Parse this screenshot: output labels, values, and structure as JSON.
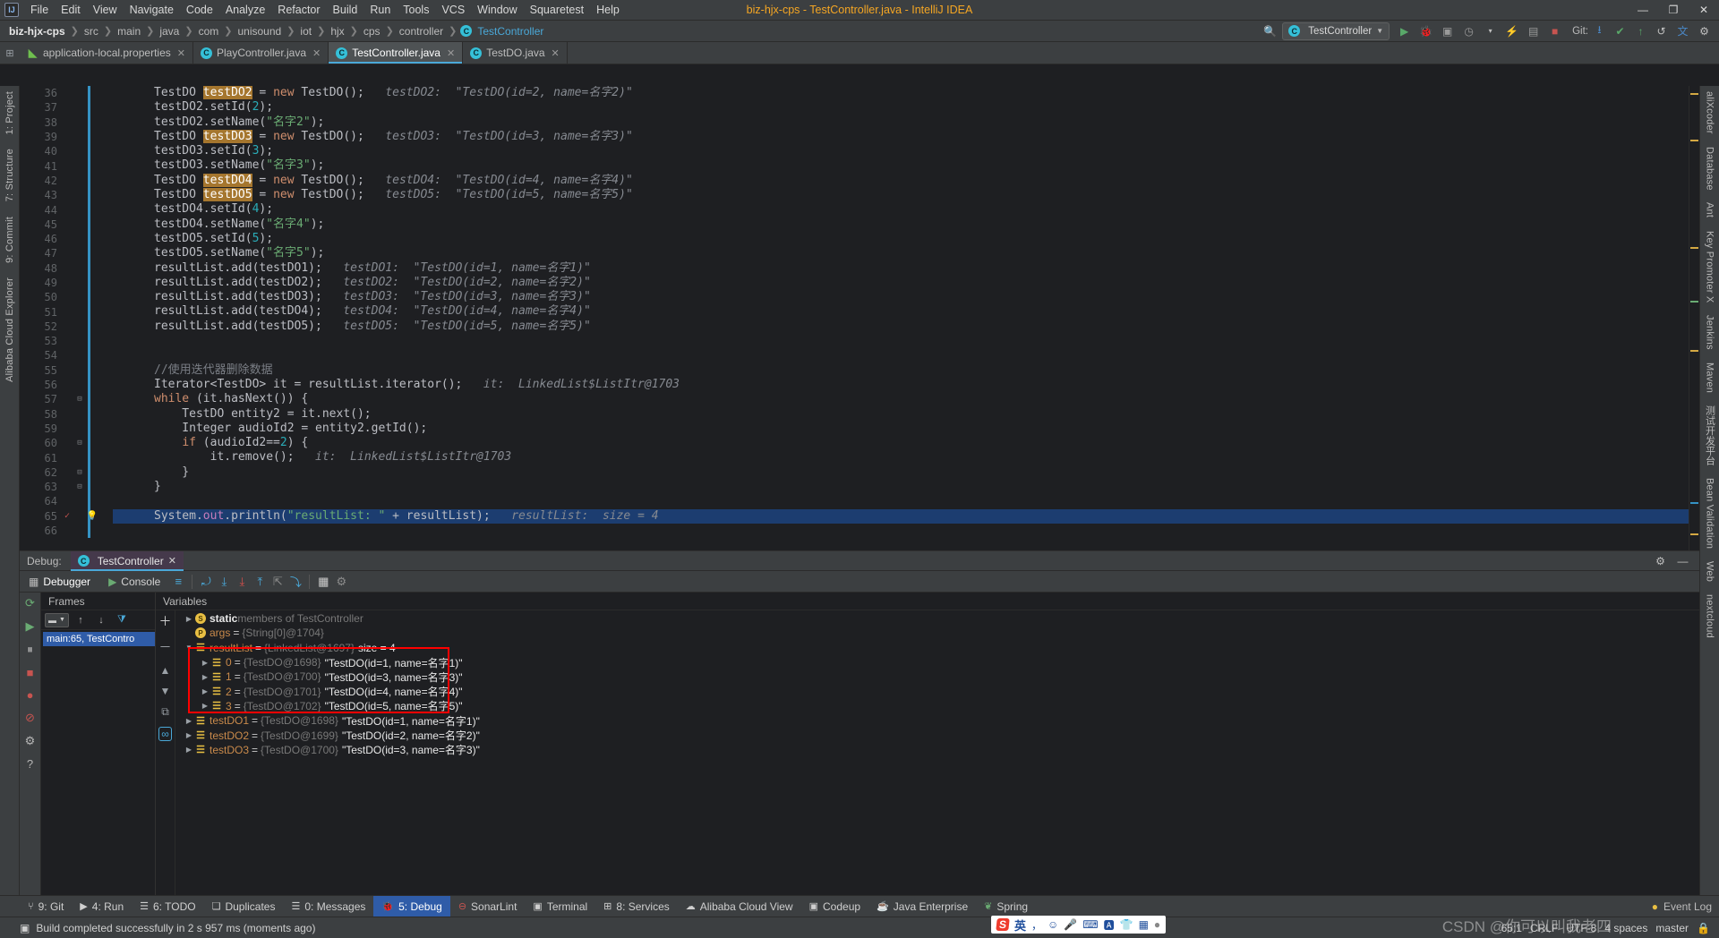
{
  "window": {
    "title": "biz-hjx-cps - TestController.java - IntelliJ IDEA",
    "logo": "IJ",
    "minimize": "—",
    "maximize": "❐",
    "close": "✕"
  },
  "menu": [
    "File",
    "Edit",
    "View",
    "Navigate",
    "Code",
    "Analyze",
    "Refactor",
    "Build",
    "Run",
    "Tools",
    "VCS",
    "Window",
    "Squaretest",
    "Help"
  ],
  "breadcrumb": {
    "items": [
      "biz-hjx-cps",
      "src",
      "main",
      "java",
      "com",
      "unisound",
      "iot",
      "hjx",
      "cps",
      "controller"
    ],
    "leaf": "TestController",
    "leaf_icon": "C"
  },
  "navbar_right": {
    "run_config": "TestController",
    "git_label": "Git:",
    "icons": [
      "search-everywhere-icon",
      "run-icon",
      "debug-icon",
      "coverage-icon",
      "profiler-icon",
      "more-icon",
      "stop-icon",
      "update-project-icon",
      "commit-icon",
      "rollback-icon",
      "translate-icon",
      "settings-icon"
    ]
  },
  "tabs": [
    {
      "label": "application-local.properties",
      "icon": "properties-file-icon",
      "active": false
    },
    {
      "label": "PlayController.java",
      "icon": "java-class-icon",
      "active": false
    },
    {
      "label": "TestController.java",
      "icon": "java-class-icon",
      "active": true
    },
    {
      "label": "TestDO.java",
      "icon": "java-class-icon",
      "active": false
    }
  ],
  "left_rail": {
    "top": [
      "1: Project",
      "7: Structure"
    ],
    "commit": "9: Commit",
    "explorer": "Alibaba Cloud Explorer"
  },
  "right_rail": [
    "aliXcoder",
    "Database",
    "Ant",
    "Key Promoter X",
    "Jenkins",
    "Maven",
    "测试开发平台",
    "Bean Validation",
    "Web",
    "nextcloud"
  ],
  "editor": {
    "first_line": 36,
    "highlight_line": 65,
    "lines": [
      {
        "n": 36,
        "frag": [
          {
            "t": "TestDO ",
            "c": "t"
          },
          {
            "t": "testDO2",
            "c": "hl-var"
          },
          {
            "t": " = ",
            "c": "t"
          },
          {
            "t": "new",
            "c": "k"
          },
          {
            "t": " TestDO();",
            "c": "t"
          },
          {
            "t": "   testDO2:  \"TestDO(id=2, name=名字2)\"",
            "c": "hint"
          }
        ]
      },
      {
        "n": 37,
        "frag": [
          {
            "t": "testDO2.setId(",
            "c": "t"
          },
          {
            "t": "2",
            "c": "n"
          },
          {
            "t": ");",
            "c": "t"
          }
        ]
      },
      {
        "n": 38,
        "frag": [
          {
            "t": "testDO2.setName(",
            "c": "t"
          },
          {
            "t": "\"名字2\"",
            "c": "s"
          },
          {
            "t": ");",
            "c": "t"
          }
        ]
      },
      {
        "n": 39,
        "frag": [
          {
            "t": "TestDO ",
            "c": "t"
          },
          {
            "t": "testDO3",
            "c": "hl-var"
          },
          {
            "t": " = ",
            "c": "t"
          },
          {
            "t": "new",
            "c": "k"
          },
          {
            "t": " TestDO();",
            "c": "t"
          },
          {
            "t": "   testDO3:  \"TestDO(id=3, name=名字3)\"",
            "c": "hint"
          }
        ]
      },
      {
        "n": 40,
        "frag": [
          {
            "t": "testDO3.setId(",
            "c": "t"
          },
          {
            "t": "3",
            "c": "n"
          },
          {
            "t": ");",
            "c": "t"
          }
        ]
      },
      {
        "n": 41,
        "frag": [
          {
            "t": "testDO3.setName(",
            "c": "t"
          },
          {
            "t": "\"名字3\"",
            "c": "s"
          },
          {
            "t": ");",
            "c": "t"
          }
        ]
      },
      {
        "n": 42,
        "frag": [
          {
            "t": "TestDO ",
            "c": "t"
          },
          {
            "t": "testDO4",
            "c": "hl-var"
          },
          {
            "t": " = ",
            "c": "t"
          },
          {
            "t": "new",
            "c": "k"
          },
          {
            "t": " TestDO();",
            "c": "t"
          },
          {
            "t": "   testDO4:  \"TestDO(id=4, name=名字4)\"",
            "c": "hint"
          }
        ]
      },
      {
        "n": 43,
        "frag": [
          {
            "t": "TestDO ",
            "c": "t"
          },
          {
            "t": "testDO5",
            "c": "hl-var"
          },
          {
            "t": " = ",
            "c": "t"
          },
          {
            "t": "new",
            "c": "k"
          },
          {
            "t": " TestDO();",
            "c": "t"
          },
          {
            "t": "   testDO5:  \"TestDO(id=5, name=名字5)\"",
            "c": "hint"
          }
        ]
      },
      {
        "n": 44,
        "frag": [
          {
            "t": "testDO4.setId(",
            "c": "t"
          },
          {
            "t": "4",
            "c": "n"
          },
          {
            "t": ");",
            "c": "t"
          }
        ]
      },
      {
        "n": 45,
        "frag": [
          {
            "t": "testDO4.setName(",
            "c": "t"
          },
          {
            "t": "\"名字4\"",
            "c": "s"
          },
          {
            "t": ");",
            "c": "t"
          }
        ]
      },
      {
        "n": 46,
        "frag": [
          {
            "t": "testDO5.setId(",
            "c": "t"
          },
          {
            "t": "5",
            "c": "n"
          },
          {
            "t": ");",
            "c": "t"
          }
        ]
      },
      {
        "n": 47,
        "frag": [
          {
            "t": "testDO5.setName(",
            "c": "t"
          },
          {
            "t": "\"名字5\"",
            "c": "s"
          },
          {
            "t": ");",
            "c": "t"
          }
        ]
      },
      {
        "n": 48,
        "frag": [
          {
            "t": "resultList.add(testDO1);",
            "c": "t"
          },
          {
            "t": "   testDO1:  \"TestDO(id=1, name=名字1)\"",
            "c": "hint"
          }
        ]
      },
      {
        "n": 49,
        "frag": [
          {
            "t": "resultList.add(testDO2);",
            "c": "t"
          },
          {
            "t": "   testDO2:  \"TestDO(id=2, name=名字2)\"",
            "c": "hint"
          }
        ]
      },
      {
        "n": 50,
        "frag": [
          {
            "t": "resultList.add(testDO3);",
            "c": "t"
          },
          {
            "t": "   testDO3:  \"TestDO(id=3, name=名字3)\"",
            "c": "hint"
          }
        ]
      },
      {
        "n": 51,
        "frag": [
          {
            "t": "resultList.add(testDO4);",
            "c": "t"
          },
          {
            "t": "   testDO4:  \"TestDO(id=4, name=名字4)\"",
            "c": "hint"
          }
        ]
      },
      {
        "n": 52,
        "frag": [
          {
            "t": "resultList.add(testDO5);",
            "c": "t"
          },
          {
            "t": "   testDO5:  \"TestDO(id=5, name=名字5)\"",
            "c": "hint"
          }
        ]
      },
      {
        "n": 53,
        "frag": []
      },
      {
        "n": 54,
        "frag": []
      },
      {
        "n": 55,
        "frag": [
          {
            "t": "//使用迭代器删除数据",
            "c": "cm"
          }
        ]
      },
      {
        "n": 56,
        "frag": [
          {
            "t": "Iterator<TestDO> it = resultList.iterator();",
            "c": "t"
          },
          {
            "t": "   it:  LinkedList$ListItr@1703",
            "c": "hint"
          }
        ]
      },
      {
        "n": 57,
        "frag": [
          {
            "t": "while",
            "c": "k"
          },
          {
            "t": " (it.hasNext()) {",
            "c": "t"
          }
        ]
      },
      {
        "n": 58,
        "frag": [
          {
            "t": "    TestDO entity2 = it.next();",
            "c": "t"
          }
        ]
      },
      {
        "n": 59,
        "frag": [
          {
            "t": "    Integer audioId2 = entity2.getId();",
            "c": "t"
          }
        ]
      },
      {
        "n": 60,
        "frag": [
          {
            "t": "    ",
            "c": "t"
          },
          {
            "t": "if",
            "c": "k"
          },
          {
            "t": " (audioId2==",
            "c": "t"
          },
          {
            "t": "2",
            "c": "n"
          },
          {
            "t": ") {",
            "c": "t"
          }
        ]
      },
      {
        "n": 61,
        "frag": [
          {
            "t": "        it.remove();",
            "c": "t"
          },
          {
            "t": "   it:  LinkedList$ListItr@1703",
            "c": "hint"
          }
        ]
      },
      {
        "n": 62,
        "frag": [
          {
            "t": "    }",
            "c": "t"
          }
        ]
      },
      {
        "n": 63,
        "frag": [
          {
            "t": "}",
            "c": "t"
          }
        ]
      },
      {
        "n": 64,
        "frag": []
      },
      {
        "n": 65,
        "frag": [
          {
            "t": "System.",
            "c": "t"
          },
          {
            "t": "out",
            "c": "f"
          },
          {
            "t": ".println(",
            "c": "t"
          },
          {
            "t": "\"resultList: \"",
            "c": "s"
          },
          {
            "t": " + resultList);",
            "c": "t"
          },
          {
            "t": "   resultList:  size = 4",
            "c": "hint"
          }
        ]
      },
      {
        "n": 66,
        "frag": []
      }
    ]
  },
  "debug": {
    "panel_label": "Debug:",
    "session_tab": "TestController",
    "tabs": [
      {
        "label": "Debugger",
        "icon": "debugger-icon"
      },
      {
        "label": "Console",
        "icon": "console-icon"
      }
    ],
    "step_icons": [
      "layout-icon",
      "step-over-icon",
      "step-into-icon",
      "force-step-into-icon",
      "step-out-icon",
      "drop-frame-icon",
      "run-to-cursor-icon",
      "evaluate-icon",
      "settings-icon"
    ],
    "frames_title": "Frames",
    "frame_item": "main:65, TestContro",
    "variables_title": "Variables",
    "variables": [
      {
        "indent": 0,
        "arrow": "▶",
        "badge": "S",
        "badge_type": "static",
        "name": "static",
        "bold": true,
        "dim": " members of TestController",
        "eq": "",
        "val": ""
      },
      {
        "indent": 0,
        "arrow": "",
        "badge": "P",
        "badge_type": "param",
        "name": "args",
        "bold": false,
        "dim": "{String[0]@1704}",
        "eq": "=",
        "val": ""
      },
      {
        "indent": 0,
        "arrow": "▼",
        "badge": "☰",
        "badge_type": "list",
        "name": "resultList",
        "bold": false,
        "dim": "{LinkedList@1697}",
        "eq": "=",
        "val": "size = 4"
      },
      {
        "indent": 1,
        "arrow": "▶",
        "badge": "☰",
        "badge_type": "list",
        "name": "0",
        "bold": false,
        "dim": "{TestDO@1698}",
        "eq": "=",
        "val": "\"TestDO(id=1, name=名字1)\""
      },
      {
        "indent": 1,
        "arrow": "▶",
        "badge": "☰",
        "badge_type": "list",
        "name": "1",
        "bold": false,
        "dim": "{TestDO@1700}",
        "eq": "=",
        "val": "\"TestDO(id=3, name=名字3)\""
      },
      {
        "indent": 1,
        "arrow": "▶",
        "badge": "☰",
        "badge_type": "list",
        "name": "2",
        "bold": false,
        "dim": "{TestDO@1701}",
        "eq": "=",
        "val": "\"TestDO(id=4, name=名字4)\""
      },
      {
        "indent": 1,
        "arrow": "▶",
        "badge": "☰",
        "badge_type": "list",
        "name": "3",
        "bold": false,
        "dim": "{TestDO@1702}",
        "eq": "=",
        "val": "\"TestDO(id=5, name=名字5)\""
      },
      {
        "indent": 0,
        "arrow": "▶",
        "badge": "☰",
        "badge_type": "list",
        "name": "testDO1",
        "bold": false,
        "dim": "{TestDO@1698}",
        "eq": "=",
        "val": "\"TestDO(id=1, name=名字1)\""
      },
      {
        "indent": 0,
        "arrow": "▶",
        "badge": "☰",
        "badge_type": "list",
        "name": "testDO2",
        "bold": false,
        "dim": "{TestDO@1699}",
        "eq": "=",
        "val": "\"TestDO(id=2, name=名字2)\""
      },
      {
        "indent": 0,
        "arrow": "▶",
        "badge": "☰",
        "badge_type": "list",
        "name": "testDO3",
        "bold": false,
        "dim": "{TestDO@1700}",
        "eq": "=",
        "val": "\"TestDO(id=3, name=名字3)\""
      }
    ],
    "highlight_color": "#ff0000"
  },
  "toolwindows": [
    {
      "label": "9: Git",
      "icon": "git-icon",
      "active": false
    },
    {
      "label": "4: Run",
      "icon": "run-icon",
      "active": false
    },
    {
      "label": "6: TODO",
      "icon": "todo-icon",
      "active": false
    },
    {
      "label": "Duplicates",
      "icon": "duplicates-icon",
      "active": false
    },
    {
      "label": "0: Messages",
      "icon": "messages-icon",
      "active": false
    },
    {
      "label": "5: Debug",
      "icon": "debug-icon",
      "active": true
    },
    {
      "label": "SonarLint",
      "icon": "sonarlint-icon",
      "active": false
    },
    {
      "label": "Terminal",
      "icon": "terminal-icon",
      "active": false
    },
    {
      "label": "8: Services",
      "icon": "services-icon",
      "active": false
    },
    {
      "label": "Alibaba Cloud View",
      "icon": "cloud-icon",
      "active": false
    },
    {
      "label": "Codeup",
      "icon": "codeup-icon",
      "active": false
    },
    {
      "label": "Java Enterprise",
      "icon": "java-enterprise-icon",
      "active": false
    },
    {
      "label": "Spring",
      "icon": "spring-icon",
      "active": false
    }
  ],
  "event_log": "Event Log",
  "status": {
    "message": "Build completed successfully in 2 s 957 ms (moments ago)",
    "caret": "65:1",
    "line_sep": "CRLF",
    "encoding": "UTF-8",
    "indent": "4 spaces",
    "branch": "master"
  },
  "ime": {
    "logo": "S",
    "lang": "英",
    "icons": [
      "comma-icon",
      "emoji-icon",
      "mic-icon",
      "keyboard-icon",
      "translate-icon",
      "skin-icon",
      "apps-icon"
    ]
  },
  "watermark": "CSDN @你可以叫我老四",
  "colors": {
    "accent": "#4aa8d8",
    "selection": "#1c3d70",
    "title": "#f5a623",
    "highlight_box": "#ff0000"
  }
}
